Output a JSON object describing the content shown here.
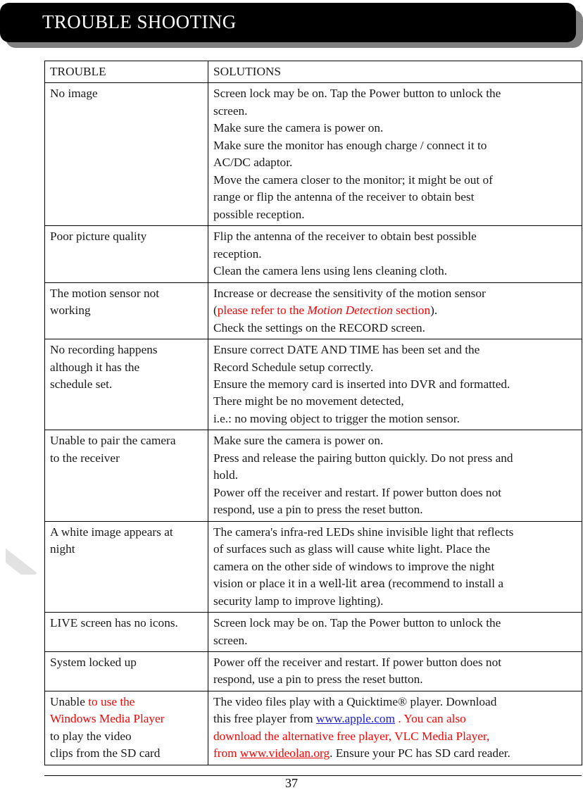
{
  "document": {
    "banner_title": "TROUBLE SHOOTING",
    "page_number": "37",
    "colors": {
      "banner_background": "#000000",
      "banner_shadow": "#808080",
      "banner_text": "#ffffff",
      "highlight_red": "#ff0000",
      "link_blue": "#2020d0",
      "body_text": "#1a1a1a",
      "page_background": "#ffffff"
    }
  },
  "table": {
    "headers": {
      "trouble": "TROUBLE",
      "solutions": "SOLUTIONS"
    },
    "rows": [
      {
        "trouble_lines": [
          "No image"
        ],
        "solution_lines": [
          "Screen lock may be on. Tap the Power button to unlock the",
          "screen.",
          "Make sure the camera is power on.",
          "Make sure the monitor has enough charge / connect it to",
          "AC/DC adaptor.",
          "Move the camera closer to the monitor; it might be out of",
          "range or flip the antenna of the receiver to obtain best",
          "possible reception."
        ]
      },
      {
        "trouble_lines": [
          "Poor picture quality"
        ],
        "solution_lines": [
          "Flip the antenna of the receiver to obtain best possible",
          "reception.",
          "Clean the camera lens using lens cleaning cloth."
        ]
      },
      {
        "trouble_lines": [
          "The motion sensor not",
          "working"
        ],
        "solution_lines": [
          "Increase or decrease the sensitivity of the motion sensor",
          "(please refer to the Motion Detection section).",
          "Check the settings on the RECORD screen."
        ],
        "solution_rich": {
          "line2_open_paren": "(",
          "line2_red_a": "please refer to the ",
          "line2_red_italic": "Motion Detection",
          "line2_red_b": " section",
          "line2_close_paren": ")."
        }
      },
      {
        "trouble_lines": [
          "No recording happens",
          "although it has the",
          "schedule set."
        ],
        "solution_lines": [
          "Ensure correct DATE AND TIME has been set and the",
          "Record Schedule setup correctly.",
          "Ensure the memory card is inserted into DVR and formatted.",
          "There might be no movement detected,",
          "i.e.: no moving object to trigger the motion sensor."
        ]
      },
      {
        "trouble_lines": [
          "Unable to pair the camera",
          "to the receiver"
        ],
        "solution_lines": [
          "Make sure the camera is power on.",
          "Press and release the pairing button quickly. Do not press and",
          "hold.",
          "Power off the receiver and restart. If power button does not",
          "respond, use a pin to press the reset button."
        ]
      },
      {
        "trouble_lines": [
          "A white image appears at",
          "night"
        ],
        "solution_lines": [
          "The camera's infra-red LEDs shine invisible light that reflects",
          "of surfaces such as glass will cause white light. Place the",
          "camera on the other side of windows to improve the night",
          "vision or place it in a well-lit area (recommend to install a",
          "security lamp to improve lighting)."
        ],
        "solution_rich": {
          "line4_a": "vision or place it in a ",
          "line4_altfont": "well-lit area",
          "line4_b": " (recommend to install a"
        }
      },
      {
        "trouble_lines": [
          "LIVE screen has no icons."
        ],
        "solution_lines": [
          "Screen lock may be on. Tap the Power button to unlock the",
          "screen."
        ]
      },
      {
        "trouble_lines": [
          "System locked up"
        ],
        "solution_lines": [
          "Power off the receiver and restart. If power button does not",
          "respond, use a pin to press the reset button."
        ]
      },
      {
        "trouble_lines": [
          "Unable to use the",
          "Windows Media Player",
          "to play the video",
          "clips from the SD card"
        ],
        "solution_lines": [
          "The video files play with a Quicktime® player. Download",
          "this free player from www.apple.com . You can also",
          "download the alternative free player, VLC Media Player,",
          "from www.videolan.org. Ensure your PC has SD card reader."
        ],
        "trouble_rich": {
          "line1_black": "Unable ",
          "line1_red": "to use the",
          "line2_red": "Windows Media Player",
          "line3_black": "to play the video",
          "line4_black": "clips from the SD card"
        },
        "solution_rich": {
          "line1": "The video files play with a Quicktime® player. Download",
          "line2_black": "this free player from ",
          "line2_link": "www.apple.com",
          "line2_red_tail": " . You can also",
          "line3_red": "download the alternative free player, VLC Media Player,",
          "line4_red_from": "from ",
          "line4_link": "www.videolan.org",
          "line4_black_tail": ". Ensure your PC has SD card reader."
        }
      }
    ]
  }
}
